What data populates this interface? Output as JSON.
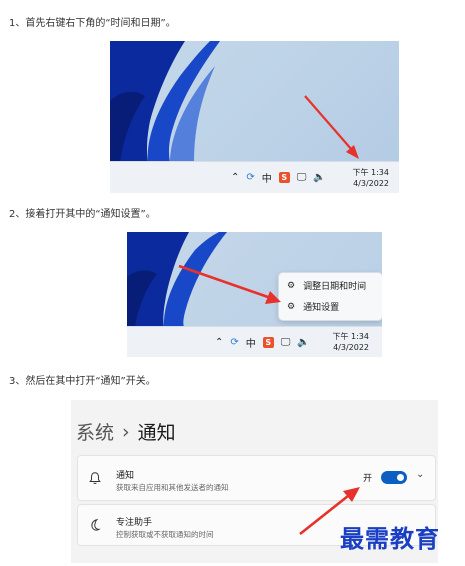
{
  "steps": {
    "s1": "1、首先右键右下角的“时间和日期”。",
    "s2": "2、接着打开其中的“通知设置”。",
    "s3": "3、然后在其中打开“通知”开关。"
  },
  "tray": {
    "ime": "中",
    "sogou": "S",
    "time": "下午 1:34",
    "date": "4/3/2022"
  },
  "context_menu": {
    "items": [
      "调整日期和时间",
      "通知设置"
    ]
  },
  "settings": {
    "breadcrumb_parent": "系统",
    "breadcrumb_sep": "›",
    "page_title": "通知",
    "notifications": {
      "title": "通知",
      "desc": "获取来自应用和其他发送者的通知",
      "toggle_label": "开",
      "toggle_on": true
    },
    "focus_assist": {
      "title": "专注助手",
      "desc": "控制获取或不获取通知的时间"
    }
  },
  "watermark": "最需教育",
  "colors": {
    "arrow": "#e8312a",
    "toggle": "#0a5fc0",
    "wallpaper_swirl": "#0b2a9e"
  }
}
